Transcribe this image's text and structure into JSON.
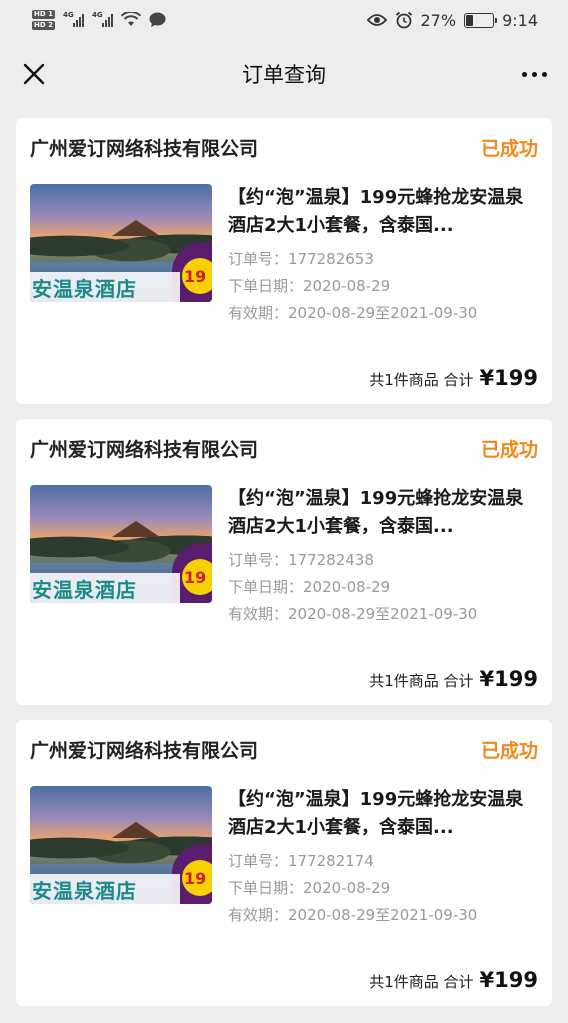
{
  "status_bar": {
    "hd1": "HD 1",
    "hd2": "HD 2",
    "net1": "4G",
    "net2": "4G",
    "battery_percent": "27%",
    "battery_level": 0.27,
    "time": "9:14",
    "icons": [
      "wifi-icon",
      "message-icon",
      "eye-icon",
      "alarm-icon",
      "battery-icon"
    ]
  },
  "nav": {
    "title": "订单查询",
    "close_icon": "close-icon",
    "more_icon": "more-icon"
  },
  "orders": [
    {
      "shop": "广州爱订网络科技有限公司",
      "status": "已成功",
      "image_text": "安温泉酒店",
      "image_price": "19",
      "title": "【约“泡”温泉】199元蜂抢龙安温泉酒店2大1小套餐，含泰国...",
      "order_no": "订单号：177282653",
      "order_date": "下单日期：2020-08-29",
      "validity": "有效期：2020-08-29至2021-09-30",
      "count_text": "共1件商品 合计",
      "total": "¥199"
    },
    {
      "shop": "广州爱订网络科技有限公司",
      "status": "已成功",
      "image_text": "安温泉酒店",
      "image_price": "19",
      "title": "【约“泡”温泉】199元蜂抢龙安温泉酒店2大1小套餐，含泰国...",
      "order_no": "订单号：177282438",
      "order_date": "下单日期：2020-08-29",
      "validity": "有效期：2020-08-29至2021-09-30",
      "count_text": "共1件商品 合计",
      "total": "¥199"
    },
    {
      "shop": "广州爱订网络科技有限公司",
      "status": "已成功",
      "image_text": "安温泉酒店",
      "image_price": "19",
      "title": "【约“泡”温泉】199元蜂抢龙安温泉酒店2大1小套餐，含泰国...",
      "order_no": "订单号：177282174",
      "order_date": "下单日期：2020-08-29",
      "validity": "有效期：2020-08-29至2021-09-30",
      "count_text": "共1件商品 合计",
      "total": "¥199"
    }
  ],
  "colors": {
    "status_success": "#ee8a1e",
    "background": "#ededed",
    "card": "#ffffff"
  }
}
